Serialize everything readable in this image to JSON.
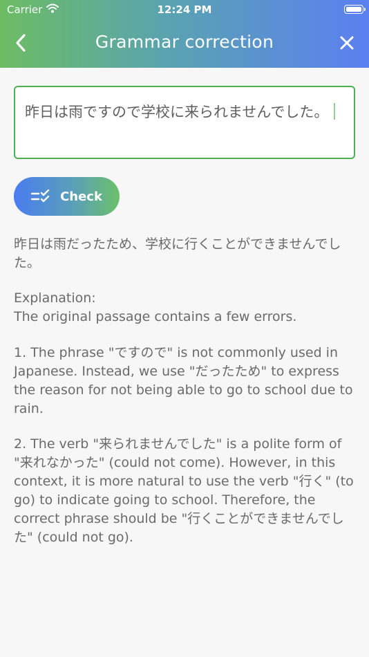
{
  "status_bar": {
    "carrier": "Carrier",
    "time": "12:24 PM"
  },
  "nav": {
    "title": "Grammar correction"
  },
  "input": {
    "text": "昨日は雨ですので学校に来られませんでした。"
  },
  "check_button": {
    "label": "Check"
  },
  "result": {
    "corrected": "昨日は雨だったため、学校に行くことができませんでした。",
    "explanation_heading": "Explanation:",
    "explanation_intro": "The original passage contains a few errors.",
    "point1": "1. The phrase \"ですので\" is not commonly used in Japanese. Instead, we use \"だったため\" to express the reason for not being able to go to school due to rain.",
    "point2": "2. The verb \"来られませんでした\" is a polite form of \"来れなかった\" (could not come). However, in this context, it is more natural to use the verb \"行く\" (to go) to indicate going to school. Therefore, the correct phrase should be \"行くことができませんでした\" (could not go)."
  },
  "colors": {
    "header_start": "#6cbc63",
    "header_end": "#5b7ff1",
    "input_border": "#4caf50",
    "button_start": "#4a7cf0",
    "button_end": "#6cc06a",
    "text": "#6a6a6a"
  },
  "icons": [
    "wifi-icon",
    "battery-icon",
    "back-chevron-icon",
    "close-icon",
    "check-list-icon"
  ]
}
